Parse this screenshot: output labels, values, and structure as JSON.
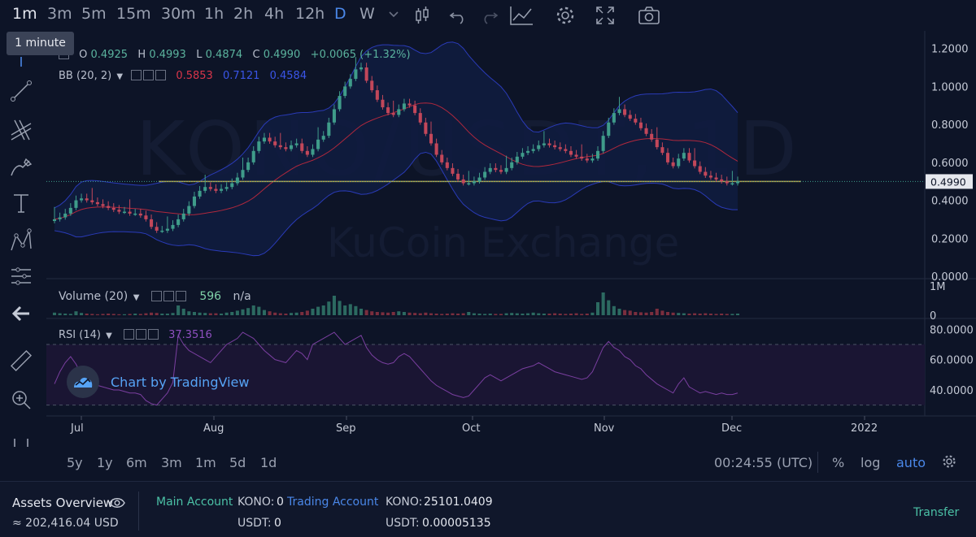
{
  "timeframes": [
    "1m",
    "3m",
    "5m",
    "15m",
    "30m",
    "1h",
    "2h",
    "4h",
    "12h",
    "D",
    "W"
  ],
  "tooltip": "1 minute",
  "ohlc": {
    "o_label": "O",
    "o": "0.4925",
    "h_label": "H",
    "h": "0.4993",
    "l_label": "L",
    "l": "0.4874",
    "c_label": "C",
    "c": "0.4990",
    "change": "+0.0065 (+1.32%)"
  },
  "bb": {
    "label": "BB (20, 2)",
    "v1": "0.5853",
    "v2": "0.7121",
    "v3": "0.4584"
  },
  "volume": {
    "label": "Volume (20)",
    "value": "596",
    "na": "n/a"
  },
  "rsi": {
    "label": "RSI (14)",
    "value": "37.3516"
  },
  "watermark": {
    "title": "KONO/USDT, 1D",
    "exchange": "KuCoin Exchange"
  },
  "tv_badge": "Chart by TradingView",
  "price_axis": [
    "1.2000",
    "1.0000",
    "0.8000",
    "0.6000",
    "0.4000",
    "0.2000",
    "0.0000"
  ],
  "current_price": "0.4990",
  "volume_axis": [
    "1M",
    "0"
  ],
  "rsi_axis": [
    "80.0000",
    "60.0000",
    "40.0000"
  ],
  "time_axis": [
    "Jul",
    "Aug",
    "Sep",
    "Oct",
    "Nov",
    "Dec",
    "2022"
  ],
  "ranges": [
    "5y",
    "1y",
    "6m",
    "3m",
    "1m",
    "5d",
    "1d"
  ],
  "clock": "00:24:55 (UTC)",
  "scale_options": {
    "percent": "%",
    "log": "log",
    "auto": "auto"
  },
  "assets": {
    "title": "Assets Overview",
    "total": "≈ 202,416.04 USD",
    "main_account": "Main Account",
    "main_kono_label": "KONO:",
    "main_kono": "0",
    "main_usdt_label": "USDT:",
    "main_usdt": "0",
    "trading_account": "Trading Account",
    "trading_kono_label": "KONO:",
    "trading_kono": "25101.0409",
    "trading_usdt_label": "USDT:",
    "trading_usdt": "0.00005135",
    "transfer": "Transfer"
  },
  "colors": {
    "up": "#3f9c8a",
    "down": "#c2475a",
    "accent": "#4a87e8",
    "rsi": "#7a3fa0",
    "bb_upper": "#2a3bb8",
    "bb_basis": "#b0283d"
  },
  "chart_data": {
    "type": "candlestick",
    "title": "KONO/USDT, 1D",
    "x_ticks": [
      "Jul",
      "Aug",
      "Sep",
      "Oct",
      "Nov",
      "Dec",
      "2022"
    ],
    "y_ticks": [
      0.0,
      0.2,
      0.4,
      0.6,
      0.8,
      1.0,
      1.2
    ],
    "ylim": [
      0.0,
      1.25
    ],
    "close_series": [
      0.3,
      0.31,
      0.33,
      0.36,
      0.4,
      0.41,
      0.4,
      0.39,
      0.38,
      0.37,
      0.36,
      0.35,
      0.34,
      0.34,
      0.33,
      0.33,
      0.32,
      0.3,
      0.26,
      0.24,
      0.24,
      0.25,
      0.27,
      0.3,
      0.33,
      0.37,
      0.42,
      0.45,
      0.47,
      0.46,
      0.45,
      0.46,
      0.47,
      0.49,
      0.52,
      0.56,
      0.6,
      0.66,
      0.71,
      0.73,
      0.71,
      0.69,
      0.68,
      0.67,
      0.69,
      0.7,
      0.66,
      0.64,
      0.67,
      0.72,
      0.74,
      0.81,
      0.88,
      0.95,
      1.0,
      1.04,
      1.09,
      1.1,
      1.03,
      0.98,
      0.93,
      0.89,
      0.86,
      0.85,
      0.88,
      0.91,
      0.9,
      0.86,
      0.81,
      0.75,
      0.7,
      0.64,
      0.6,
      0.57,
      0.54,
      0.51,
      0.49,
      0.49,
      0.5,
      0.52,
      0.55,
      0.57,
      0.56,
      0.55,
      0.57,
      0.6,
      0.63,
      0.65,
      0.66,
      0.67,
      0.69,
      0.7,
      0.69,
      0.68,
      0.67,
      0.66,
      0.64,
      0.63,
      0.62,
      0.61,
      0.62,
      0.66,
      0.74,
      0.81,
      0.86,
      0.88,
      0.85,
      0.83,
      0.81,
      0.78,
      0.75,
      0.72,
      0.68,
      0.65,
      0.6,
      0.58,
      0.62,
      0.65,
      0.61,
      0.58,
      0.55,
      0.53,
      0.52,
      0.51,
      0.5,
      0.49,
      0.49,
      0.5
    ],
    "volume_series": [
      0.08,
      0.06,
      0.05,
      0.04,
      0.12,
      0.07,
      0.05,
      0.04,
      0.03,
      0.04,
      0.05,
      0.04,
      0.03,
      0.03,
      0.04,
      0.05,
      0.04,
      0.06,
      0.08,
      0.07,
      0.05,
      0.05,
      0.07,
      0.3,
      0.2,
      0.12,
      0.1,
      0.08,
      0.07,
      0.06,
      0.06,
      0.05,
      0.08,
      0.1,
      0.14,
      0.18,
      0.22,
      0.3,
      0.26,
      0.16,
      0.12,
      0.08,
      0.06,
      0.05,
      0.07,
      0.08,
      0.1,
      0.14,
      0.2,
      0.26,
      0.3,
      0.42,
      0.6,
      0.44,
      0.3,
      0.34,
      0.28,
      0.2,
      0.16,
      0.12,
      0.1,
      0.09,
      0.08,
      0.1,
      0.12,
      0.1,
      0.08,
      0.07,
      0.06,
      0.08,
      0.06,
      0.05,
      0.04,
      0.05,
      0.06,
      0.05,
      0.06,
      0.1,
      0.06,
      0.05,
      0.04,
      0.05,
      0.04,
      0.04,
      0.06,
      0.07,
      0.06,
      0.05,
      0.06,
      0.08,
      0.06,
      0.05,
      0.05,
      0.06,
      0.05,
      0.04,
      0.05,
      0.06,
      0.04,
      0.05,
      0.08,
      0.4,
      0.7,
      0.46,
      0.28,
      0.2,
      0.16,
      0.14,
      0.1,
      0.09,
      0.08,
      0.1,
      0.2,
      0.14,
      0.1,
      0.08,
      0.07,
      0.06,
      0.05,
      0.06,
      0.05,
      0.06,
      0.05,
      0.04,
      0.05,
      0.04,
      0.04,
      0.05
    ],
    "rsi_series": [
      44,
      52,
      58,
      62,
      57,
      50,
      47,
      45,
      43,
      42,
      41,
      40,
      40,
      39,
      38,
      38,
      37,
      33,
      31,
      30,
      34,
      38,
      45,
      76,
      70,
      66,
      64,
      62,
      60,
      58,
      62,
      66,
      70,
      72,
      74,
      78,
      76,
      74,
      70,
      66,
      63,
      60,
      59,
      58,
      62,
      66,
      64,
      60,
      70,
      72,
      74,
      76,
      78,
      74,
      70,
      72,
      74,
      76,
      68,
      63,
      60,
      58,
      57,
      58,
      62,
      64,
      62,
      58,
      54,
      50,
      46,
      43,
      41,
      39,
      37,
      36,
      35,
      36,
      40,
      44,
      48,
      50,
      48,
      46,
      48,
      50,
      52,
      54,
      55,
      56,
      58,
      56,
      54,
      52,
      51,
      50,
      49,
      48,
      47,
      48,
      52,
      60,
      68,
      72,
      68,
      66,
      62,
      60,
      56,
      54,
      50,
      47,
      44,
      42,
      40,
      38,
      44,
      48,
      42,
      40,
      38,
      39,
      38,
      37,
      38,
      37,
      37,
      38
    ],
    "reference_price": 0.499
  }
}
